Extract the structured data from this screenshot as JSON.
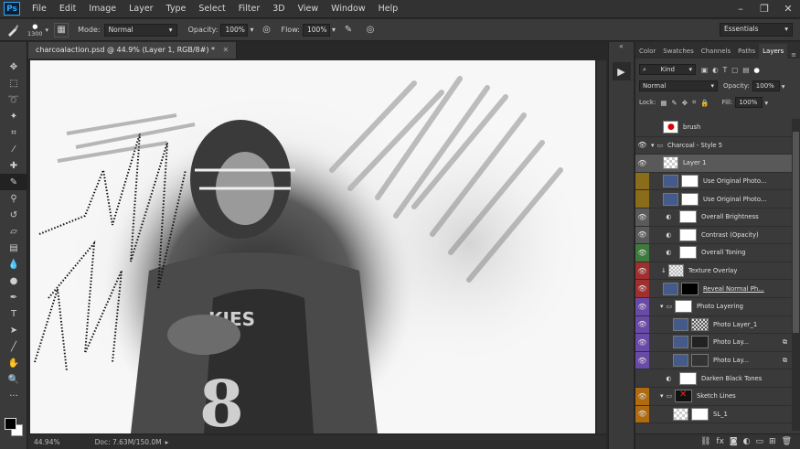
{
  "menubar": {
    "logo": "Ps",
    "items": [
      "File",
      "Edit",
      "Image",
      "Layer",
      "Type",
      "Select",
      "Filter",
      "3D",
      "View",
      "Window",
      "Help"
    ],
    "window_controls": [
      "–",
      "❐",
      "✕"
    ]
  },
  "options": {
    "brush_size": "1300",
    "mode_label": "Mode:",
    "mode_value": "Normal",
    "opacity_label": "Opacity:",
    "opacity_value": "100%",
    "flow_label": "Flow:",
    "flow_value": "100%",
    "workspace": "Essentials"
  },
  "document": {
    "tab_title": "charcoalaction.psd @ 44.9% (Layer 1, RGB/8#) *",
    "status_zoom": "44.94%",
    "status_doc": "Doc: 7.63M/150.0M"
  },
  "panel": {
    "tabs": [
      "Color",
      "Swatches",
      "Channels",
      "Paths",
      "Layers"
    ],
    "active_tab": "Layers",
    "kind_label": "Kind",
    "blend_mode": "Normal",
    "opacity_label": "Opacity:",
    "opacity_value": "100%",
    "lock_label": "Lock:",
    "fill_label": "Fill:",
    "fill_value": "100%"
  },
  "layers": [
    {
      "name": "brush",
      "tag": "",
      "visible": false,
      "type": "layer-red"
    },
    {
      "name": "Charcoal - Style 5",
      "tag": "",
      "visible": true,
      "type": "group"
    },
    {
      "name": "Layer 1",
      "tag": "",
      "visible": true,
      "type": "layer-selected"
    },
    {
      "name": "Use Original Photo...",
      "tag": "#8a6d1a",
      "visible": false,
      "type": "photo-mask"
    },
    {
      "name": "Use Original Photo...",
      "tag": "#8a6d1a",
      "visible": false,
      "type": "photo-mask"
    },
    {
      "name": "Overall Brightness",
      "tag": "#5a5a5a",
      "visible": true,
      "type": "adjust"
    },
    {
      "name": "Contrast (Opacity)",
      "tag": "#5a5a5a",
      "visible": true,
      "type": "adjust"
    },
    {
      "name": "Overall Toning",
      "tag": "#3d7a3d",
      "visible": true,
      "type": "adjust"
    },
    {
      "name": "Texture Overlay",
      "tag": "#a03030",
      "visible": true,
      "type": "texture"
    },
    {
      "name": "Reveal Normal Ph...",
      "tag": "#a03030",
      "visible": true,
      "type": "photo-black"
    },
    {
      "name": "Photo Layering",
      "tag": "#6a4aa8",
      "visible": true,
      "type": "group"
    },
    {
      "name": "Photo Layer_1",
      "tag": "#6a4aa8",
      "visible": true,
      "type": "photo"
    },
    {
      "name": "Photo Lay...",
      "tag": "#6a4aa8",
      "visible": true,
      "type": "photo-mask"
    },
    {
      "name": "Photo Lay...",
      "tag": "#6a4aa8",
      "visible": true,
      "type": "photo-mask"
    },
    {
      "name": "Darken Black Tones",
      "tag": "",
      "visible": false,
      "type": "adjust"
    },
    {
      "name": "Sketch Lines",
      "tag": "#b06a10",
      "visible": true,
      "type": "group-red"
    },
    {
      "name": "SL_1",
      "tag": "#b06a10",
      "visible": true,
      "type": "layer"
    }
  ],
  "colors": {
    "accent_blue": "#31a8ff",
    "panel_bg": "#3a3a3a",
    "selected_row": "#595959"
  }
}
